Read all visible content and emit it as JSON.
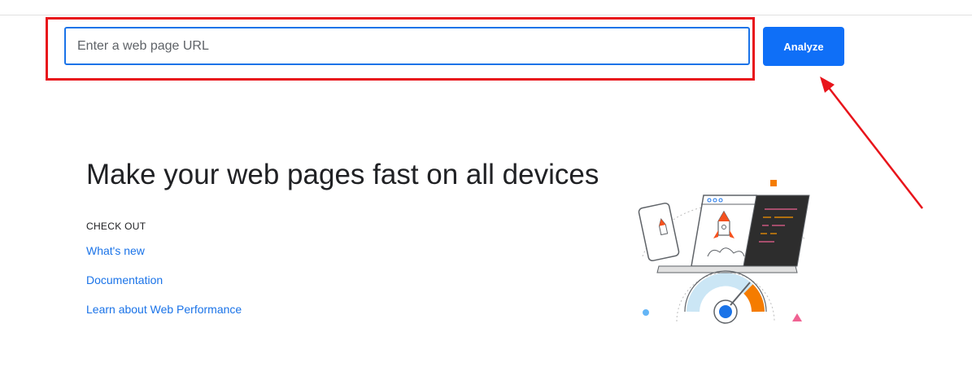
{
  "search": {
    "placeholder": "Enter a web page URL",
    "value": ""
  },
  "toolbar": {
    "analyze_label": "Analyze"
  },
  "hero": {
    "headline": "Make your web pages fast on all devices",
    "checkout_label": "CHECK OUT",
    "links": [
      {
        "label": "What's new"
      },
      {
        "label": "Documentation"
      },
      {
        "label": "Learn about Web Performance"
      }
    ]
  },
  "colors": {
    "accent": "#1a73e8",
    "button": "#0f6ff7",
    "annotation": "#e8141b",
    "gauge_orange": "#f57c00",
    "gauge_light_blue": "#cbe6f5"
  },
  "icons": {
    "illustration": "phone-browser-rocket-speed-gauge-illustration",
    "annotation": "red-arrow-icon"
  }
}
